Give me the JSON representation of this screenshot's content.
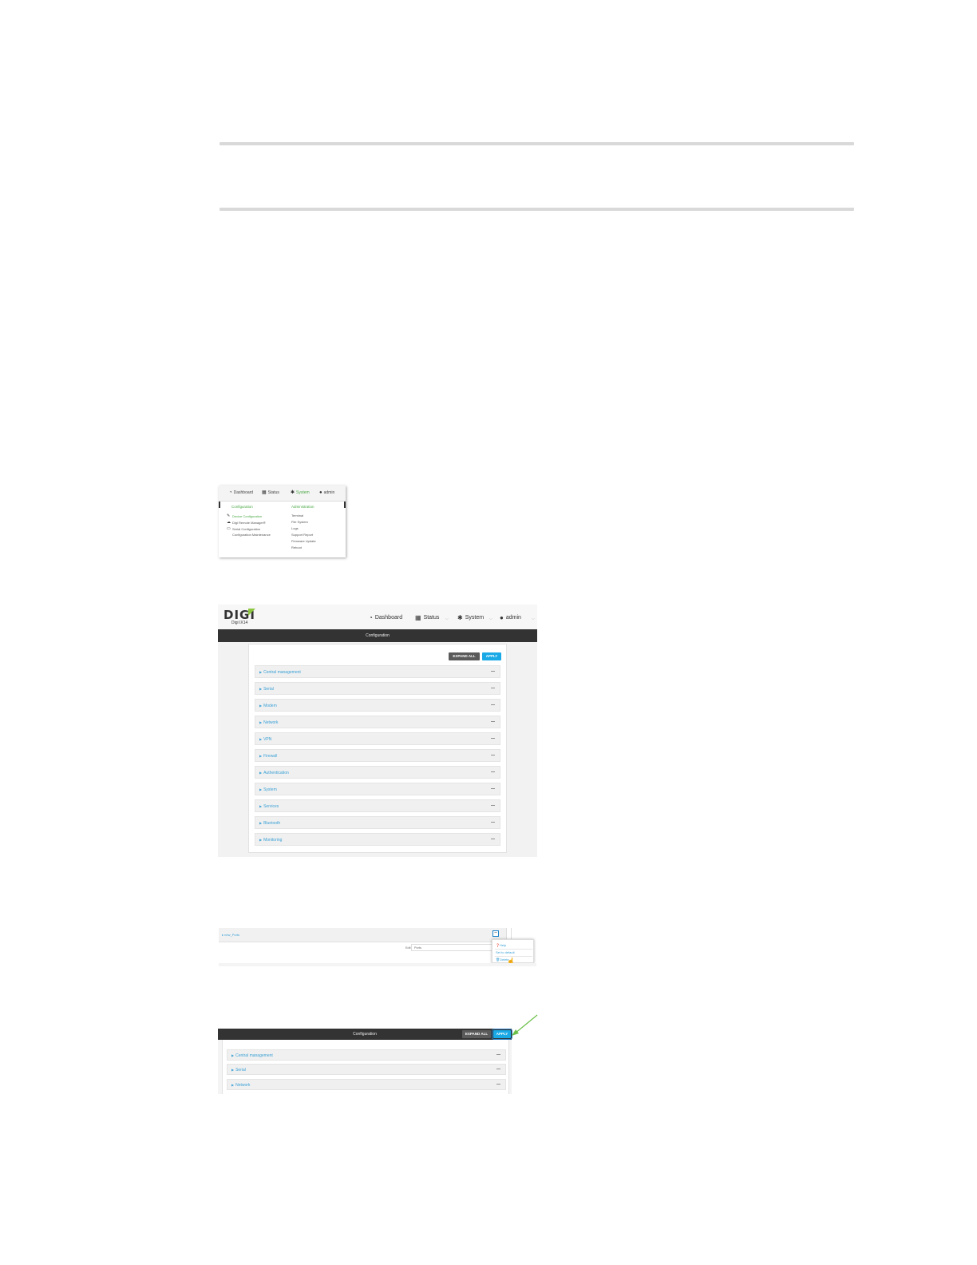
{
  "colors": {
    "accent_green": "#4aa844",
    "link_blue": "#39a0d6",
    "apply_blue": "#19a9e6",
    "dark_bar": "#333333",
    "expand_gray": "#5a5a5a",
    "arrow_green": "#6cc04a"
  },
  "menu_screenshot": {
    "nav": {
      "dashboard": "Dashboard",
      "status": "Status",
      "system": "System",
      "admin": "admin"
    },
    "configuration_header": "Configuration",
    "administration_header": "Administration",
    "configuration_items": [
      {
        "label": "Device Configuration",
        "icon": "wrench-icon"
      },
      {
        "label": "Digi Remote Manager®",
        "icon": "cloud-icon"
      },
      {
        "label": "Serial Configuration",
        "icon": "serial-icon"
      },
      {
        "label": "Configuration Maintenance",
        "icon": ""
      }
    ],
    "administration_items": [
      "Terminal",
      "File System",
      "Logs",
      "Support Report",
      "Firmware Update",
      "Reboot"
    ]
  },
  "config_screenshot": {
    "logo": "DIGI",
    "model": "Digi IX14",
    "nav": {
      "dashboard": "Dashboard",
      "status": "Status",
      "system": "System",
      "admin": "admin"
    },
    "title": "Configuration",
    "expand_all": "EXPAND ALL",
    "apply": "APPLY",
    "sections": [
      "Central management",
      "Serial",
      "Modem",
      "Network",
      "VPN",
      "Firewall",
      "Authentication",
      "System",
      "Services",
      "Bluetooth",
      "Monitoring"
    ],
    "collapse_symbol": "—"
  },
  "delete_screenshot": {
    "row_label": "new_Ports",
    "field_label": "Edit",
    "field_value": "Ports",
    "menu_items": [
      "Help",
      "Set to default",
      "Delete"
    ]
  },
  "apply_screenshot": {
    "title": "Configuration",
    "expand_all": "EXPAND ALL",
    "apply": "APPLY",
    "sections": [
      "Central management",
      "Serial",
      "Network"
    ]
  }
}
